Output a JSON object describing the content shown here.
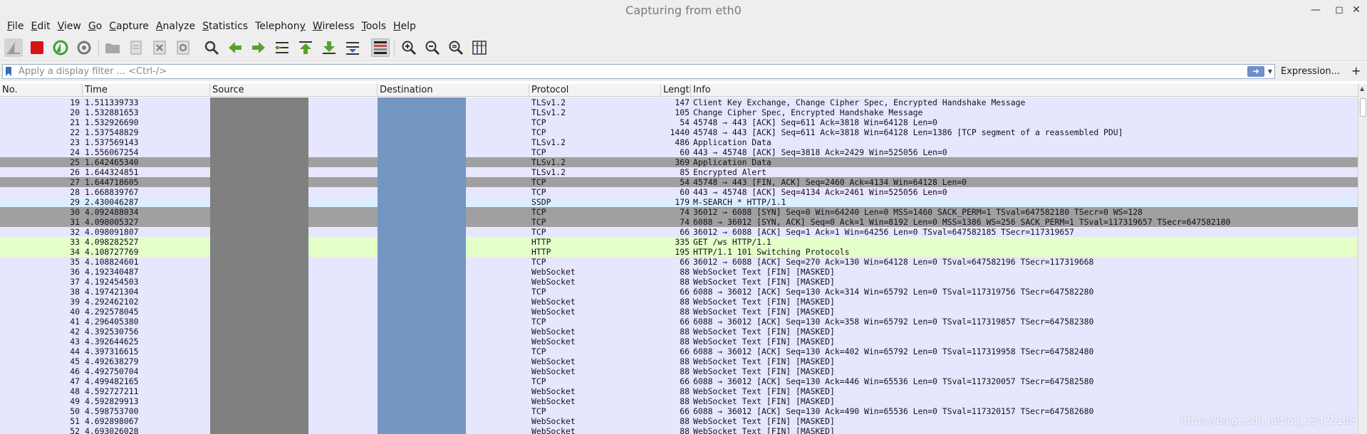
{
  "window": {
    "title": "Capturing from eth0"
  },
  "menu": [
    {
      "label": "File",
      "mnemonic": "F",
      "rest": "ile"
    },
    {
      "label": "Edit",
      "mnemonic": "E",
      "rest": "dit"
    },
    {
      "label": "View",
      "mnemonic": "V",
      "rest": "iew"
    },
    {
      "label": "Go",
      "mnemonic": "G",
      "rest": "o"
    },
    {
      "label": "Capture",
      "mnemonic": "C",
      "rest": "apture"
    },
    {
      "label": "Analyze",
      "mnemonic": "A",
      "rest": "nalyze"
    },
    {
      "label": "Statistics",
      "mnemonic": "S",
      "rest": "tatistics"
    },
    {
      "label": "Telephony",
      "mnemonic": "y",
      "rest": "Telephon"
    },
    {
      "label": "Wireless",
      "mnemonic": "W",
      "rest": "ireless"
    },
    {
      "label": "Tools",
      "mnemonic": "T",
      "rest": "ools"
    },
    {
      "label": "Help",
      "mnemonic": "H",
      "rest": "elp"
    }
  ],
  "filter": {
    "placeholder": "Apply a display filter ... <Ctrl-/>",
    "value": "",
    "expression_label": "Expression...",
    "plus_label": "+"
  },
  "columns": {
    "no": "No.",
    "time": "Time",
    "source": "Source",
    "destination": "Destination",
    "protocol": "Protocol",
    "length": "Length",
    "info": "Info"
  },
  "colors": {
    "tcp": "#e7e6ff",
    "tls": "#e7e6ff",
    "ssdp": "#daeeff",
    "http": "#e4ffc7",
    "websocket": "#e7e6ff",
    "bad": "#a0a0a0",
    "source_mask": "#808080",
    "destination_mask": "#7396c2"
  },
  "packets": [
    {
      "no": "19",
      "time": "1.511339733",
      "protocol": "TLSv1.2",
      "length": "147",
      "info": "Client Key Exchange, Change Cipher Spec, Encrypted Handshake Message",
      "color": "tls"
    },
    {
      "no": "20",
      "time": "1.532881653",
      "protocol": "TLSv1.2",
      "length": "105",
      "info": "Change Cipher Spec, Encrypted Handshake Message",
      "color": "tls"
    },
    {
      "no": "21",
      "time": "1.532926690",
      "protocol": "TCP",
      "length": "54",
      "info": "45748 → 443 [ACK] Seq=611 Ack=3818 Win=64128 Len=0",
      "color": "tcp"
    },
    {
      "no": "22",
      "time": "1.537548829",
      "protocol": "TCP",
      "length": "1440",
      "info": "45748 → 443 [ACK] Seq=611 Ack=3818 Win=64128 Len=1386 [TCP segment of a reassembled PDU]",
      "color": "tcp"
    },
    {
      "no": "23",
      "time": "1.537569143",
      "protocol": "TLSv1.2",
      "length": "486",
      "info": "Application Data",
      "color": "tls"
    },
    {
      "no": "24",
      "time": "1.556067254",
      "protocol": "TCP",
      "length": "60",
      "info": "443 → 45748 [ACK] Seq=3818 Ack=2429 Win=525056 Len=0",
      "color": "tcp"
    },
    {
      "no": "25",
      "time": "1.642465340",
      "protocol": "TLSv1.2",
      "length": "369",
      "info": "Application Data",
      "color": "bad"
    },
    {
      "no": "26",
      "time": "1.644324851",
      "protocol": "TLSv1.2",
      "length": "85",
      "info": "Encrypted Alert",
      "color": "tls"
    },
    {
      "no": "27",
      "time": "1.644718605",
      "protocol": "TCP",
      "length": "54",
      "info": "45748 → 443 [FIN, ACK] Seq=2460 Ack=4134 Win=64128 Len=0",
      "color": "bad"
    },
    {
      "no": "28",
      "time": "1.668839767",
      "protocol": "TCP",
      "length": "60",
      "info": "443 → 45748 [ACK] Seq=4134 Ack=2461 Win=525056 Len=0",
      "color": "tcp"
    },
    {
      "no": "29",
      "time": "2.430046287",
      "protocol": "SSDP",
      "length": "179",
      "info": "M-SEARCH * HTTP/1.1",
      "color": "ssdp"
    },
    {
      "no": "30",
      "time": "4.092488034",
      "protocol": "TCP",
      "length": "74",
      "info": "36012 → 6088 [SYN] Seq=0 Win=64240 Len=0 MSS=1460 SACK_PERM=1 TSval=647582180 TSecr=0 WS=128",
      "color": "bad"
    },
    {
      "no": "31",
      "time": "4.098005327",
      "protocol": "TCP",
      "length": "74",
      "info": "6088 → 36012 [SYN, ACK] Seq=0 Ack=1 Win=8192 Len=0 MSS=1386 WS=256 SACK_PERM=1 TSval=117319657 TSecr=647582180",
      "color": "bad"
    },
    {
      "no": "32",
      "time": "4.098091807",
      "protocol": "TCP",
      "length": "66",
      "info": "36012 → 6088 [ACK] Seq=1 Ack=1 Win=64256 Len=0 TSval=647582185 TSecr=117319657",
      "color": "tcp"
    },
    {
      "no": "33",
      "time": "4.098282527",
      "protocol": "HTTP",
      "length": "335",
      "info": "GET /ws HTTP/1.1",
      "color": "http"
    },
    {
      "no": "34",
      "time": "4.108727769",
      "protocol": "HTTP",
      "length": "195",
      "info": "HTTP/1.1 101 Switching Protocols",
      "color": "http"
    },
    {
      "no": "35",
      "time": "4.108824601",
      "protocol": "TCP",
      "length": "66",
      "info": "36012 → 6088 [ACK] Seq=270 Ack=130 Win=64128 Len=0 TSval=647582196 TSecr=117319668",
      "color": "tcp"
    },
    {
      "no": "36",
      "time": "4.192340487",
      "protocol": "WebSocket",
      "length": "88",
      "info": "WebSocket Text [FIN] [MASKED]",
      "color": "websocket"
    },
    {
      "no": "37",
      "time": "4.192454503",
      "protocol": "WebSocket",
      "length": "88",
      "info": "WebSocket Text [FIN] [MASKED]",
      "color": "websocket"
    },
    {
      "no": "38",
      "time": "4.197421304",
      "protocol": "TCP",
      "length": "66",
      "info": "6088 → 36012 [ACK] Seq=130 Ack=314 Win=65792 Len=0 TSval=117319756 TSecr=647582280",
      "color": "tcp"
    },
    {
      "no": "39",
      "time": "4.292462102",
      "protocol": "WebSocket",
      "length": "88",
      "info": "WebSocket Text [FIN] [MASKED]",
      "color": "websocket"
    },
    {
      "no": "40",
      "time": "4.292578045",
      "protocol": "WebSocket",
      "length": "88",
      "info": "WebSocket Text [FIN] [MASKED]",
      "color": "websocket"
    },
    {
      "no": "41",
      "time": "4.296405380",
      "protocol": "TCP",
      "length": "66",
      "info": "6088 → 36012 [ACK] Seq=130 Ack=358 Win=65792 Len=0 TSval=117319857 TSecr=647582380",
      "color": "tcp"
    },
    {
      "no": "42",
      "time": "4.392530756",
      "protocol": "WebSocket",
      "length": "88",
      "info": "WebSocket Text [FIN] [MASKED]",
      "color": "websocket"
    },
    {
      "no": "43",
      "time": "4.392644625",
      "protocol": "WebSocket",
      "length": "88",
      "info": "WebSocket Text [FIN] [MASKED]",
      "color": "websocket"
    },
    {
      "no": "44",
      "time": "4.397316615",
      "protocol": "TCP",
      "length": "66",
      "info": "6088 → 36012 [ACK] Seq=130 Ack=402 Win=65792 Len=0 TSval=117319958 TSecr=647582480",
      "color": "tcp"
    },
    {
      "no": "45",
      "time": "4.492638279",
      "protocol": "WebSocket",
      "length": "88",
      "info": "WebSocket Text [FIN] [MASKED]",
      "color": "websocket"
    },
    {
      "no": "46",
      "time": "4.492750704",
      "protocol": "WebSocket",
      "length": "88",
      "info": "WebSocket Text [FIN] [MASKED]",
      "color": "websocket"
    },
    {
      "no": "47",
      "time": "4.499482165",
      "protocol": "TCP",
      "length": "66",
      "info": "6088 → 36012 [ACK] Seq=130 Ack=446 Win=65536 Len=0 TSval=117320057 TSecr=647582580",
      "color": "tcp"
    },
    {
      "no": "48",
      "time": "4.592727211",
      "protocol": "WebSocket",
      "length": "88",
      "info": "WebSocket Text [FIN] [MASKED]",
      "color": "websocket"
    },
    {
      "no": "49",
      "time": "4.592829913",
      "protocol": "WebSocket",
      "length": "88",
      "info": "WebSocket Text [FIN] [MASKED]",
      "color": "websocket"
    },
    {
      "no": "50",
      "time": "4.598753700",
      "protocol": "TCP",
      "length": "66",
      "info": "6088 → 36012 [ACK] Seq=130 Ack=490 Win=65536 Len=0 TSval=117320157 TSecr=647582680",
      "color": "tcp"
    },
    {
      "no": "51",
      "time": "4.692898067",
      "protocol": "WebSocket",
      "length": "88",
      "info": "WebSocket Text [FIN] [MASKED]",
      "color": "websocket"
    },
    {
      "no": "52",
      "time": "4.693026028",
      "protocol": "WebSocket",
      "length": "88",
      "info": "WebSocket Text [FIN] [MASKED]",
      "color": "websocket"
    }
  ],
  "watermark": "https://blog.csdn.net/qq_33475105"
}
